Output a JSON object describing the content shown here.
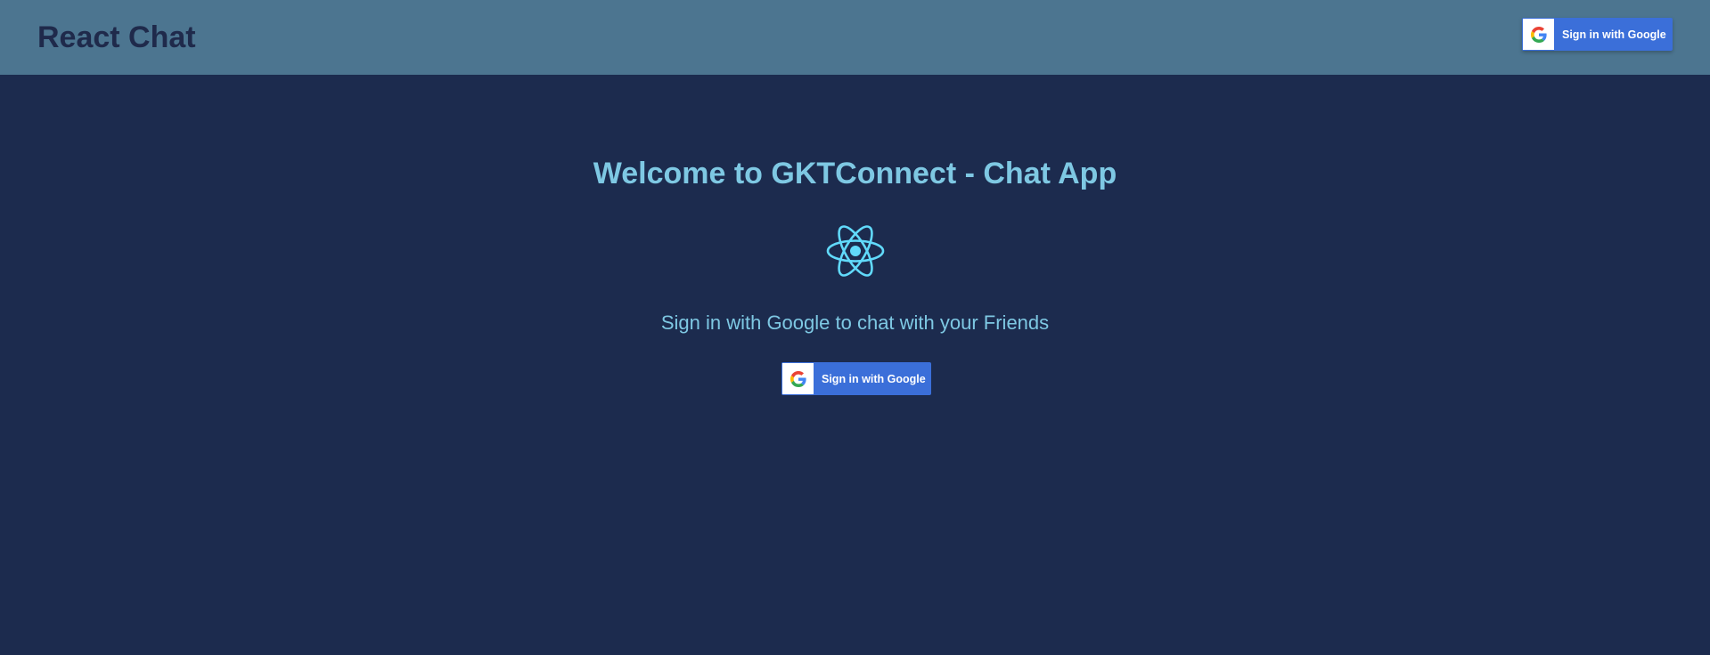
{
  "header": {
    "brand": "React Chat",
    "sign_in_button": {
      "label": "Sign in with Google",
      "icon": "google-g-icon"
    }
  },
  "main": {
    "title": "Welcome to GKTConnect - Chat App",
    "logo_icon": "react-logo-icon",
    "subtitle": "Sign in with Google to chat with your Friends",
    "sign_in_button": {
      "label": "Sign in with Google",
      "icon": "google-g-icon"
    }
  },
  "colors": {
    "page_background": "#1c2b4e",
    "header_background": "#4c7590",
    "brand_text": "#1f2a4b",
    "accent_text": "#7ec8e3",
    "google_button": "#3b6fd9",
    "react_logo": "#61dafb"
  }
}
